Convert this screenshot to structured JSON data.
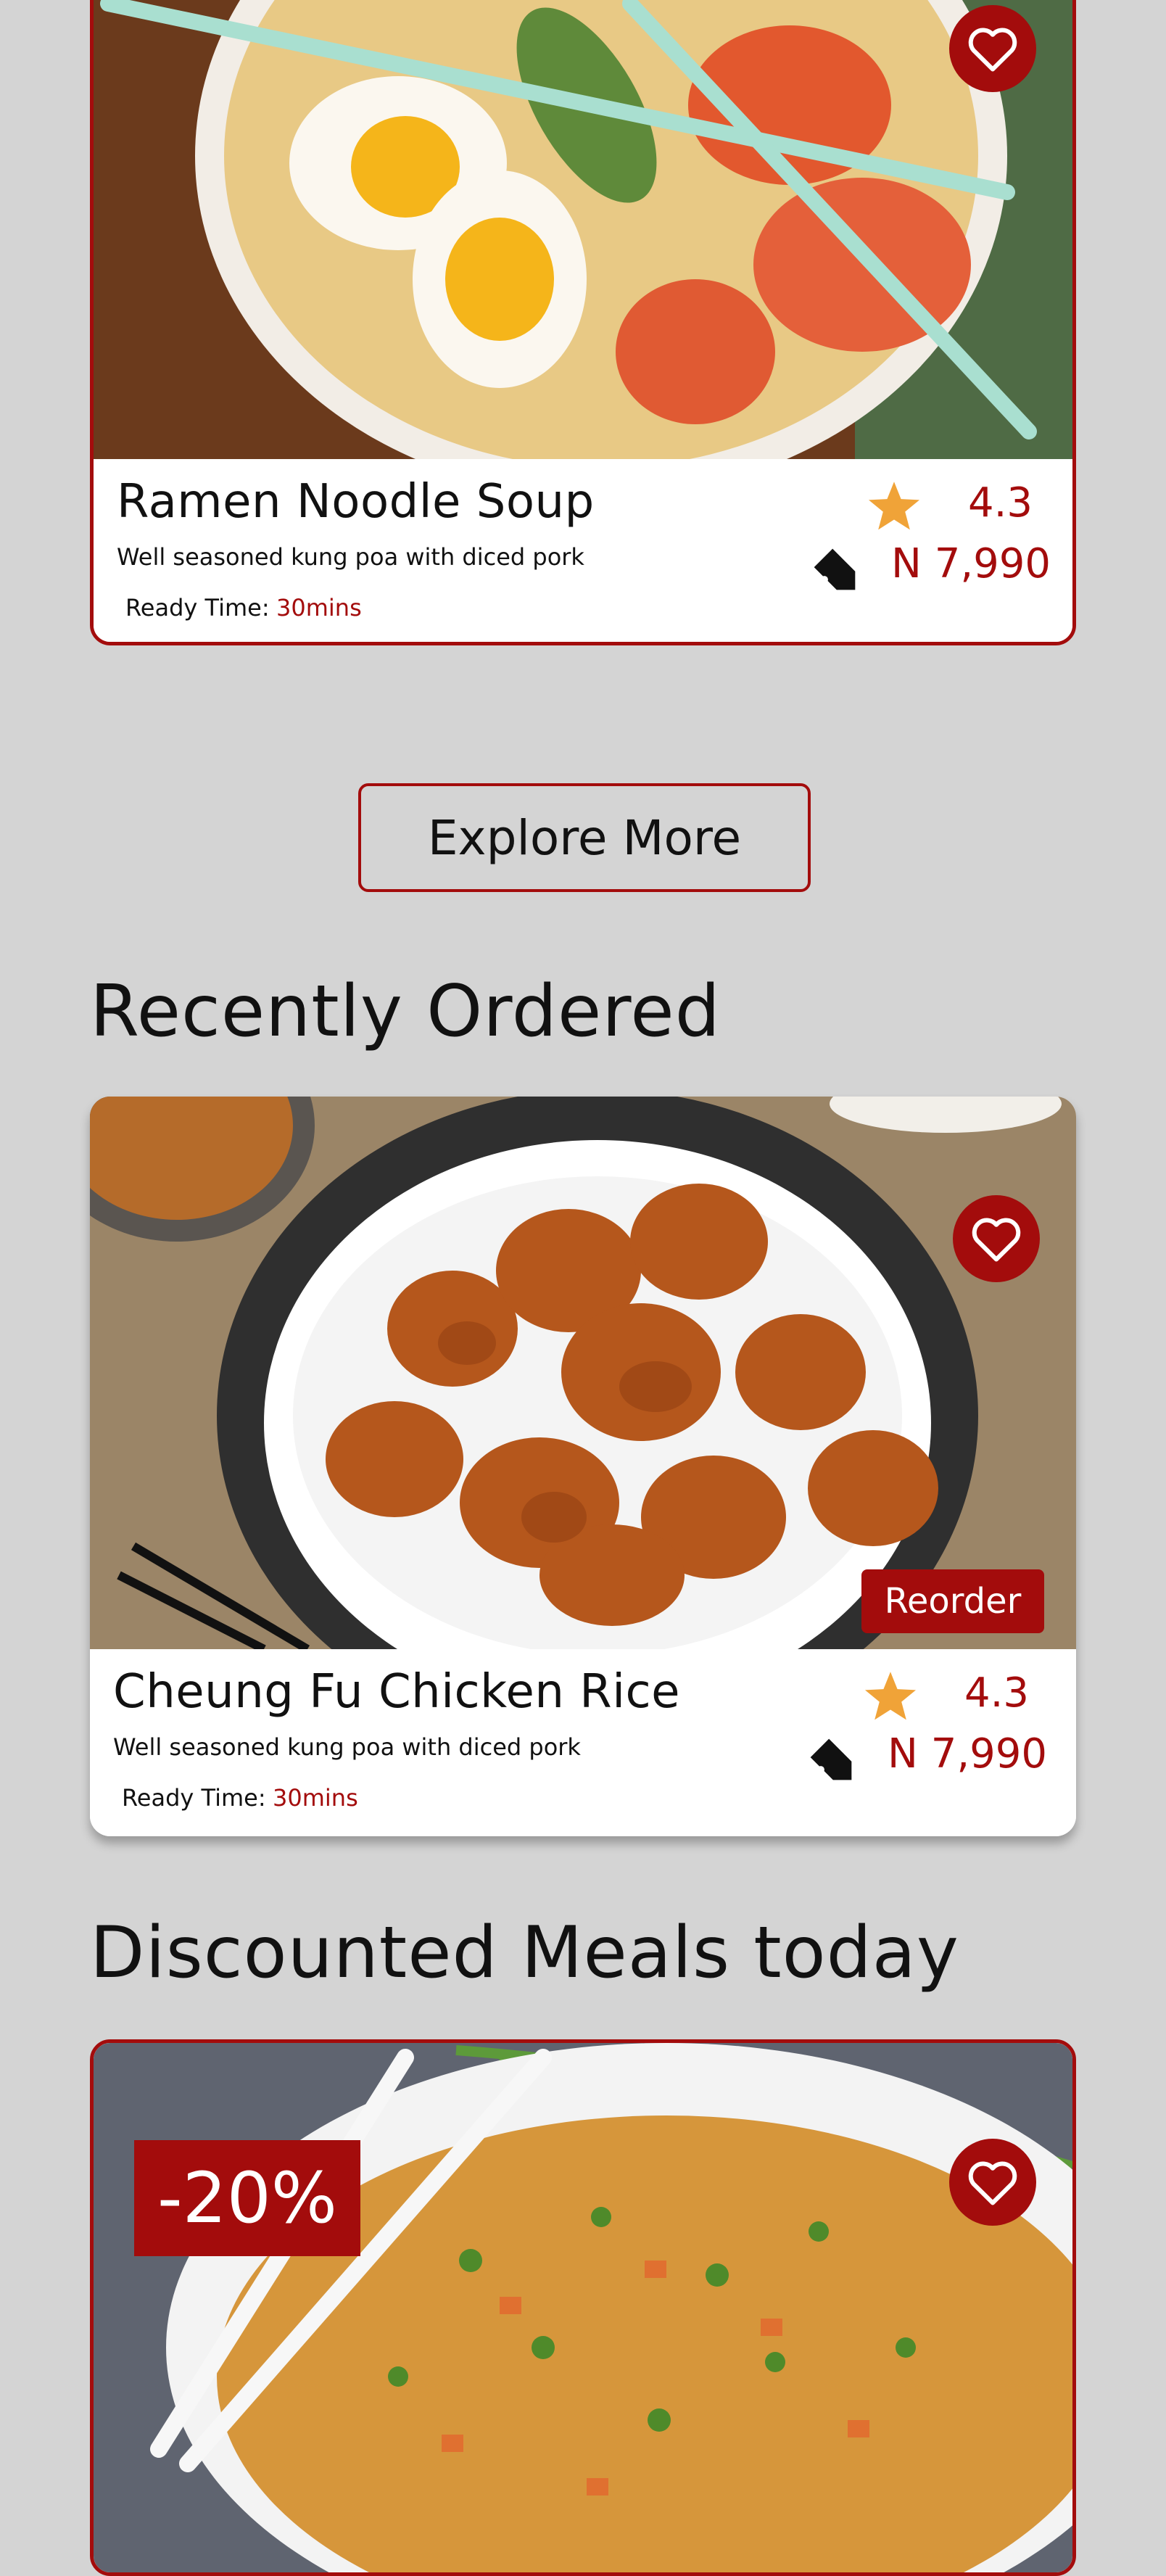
{
  "top_card": {
    "name": "Ramen Noodle Soup",
    "description": "Well seasoned kung poa with diced pork",
    "ready_label": "Ready Time:",
    "ready_value": "30mins",
    "rating": "4.3",
    "price": "N 7,990",
    "icons": [
      "heart-icon",
      "star-icon",
      "price-tag-icon"
    ]
  },
  "explore_button": "Explore More",
  "recently_ordered": {
    "title": "Recently Ordered",
    "card": {
      "name": "Cheung Fu Chicken Rice",
      "description": "Well seasoned kung poa with diced pork",
      "ready_label": "Ready Time:",
      "ready_value": "30mins",
      "rating": "4.3",
      "price": "N 7,990",
      "reorder_label": "Reorder"
    }
  },
  "discounted": {
    "title": "Discounted Meals today",
    "badge": "-20%"
  },
  "colors": {
    "accent": "#a30c0c",
    "background": "#d4d4d4",
    "star": "#f0a338"
  }
}
